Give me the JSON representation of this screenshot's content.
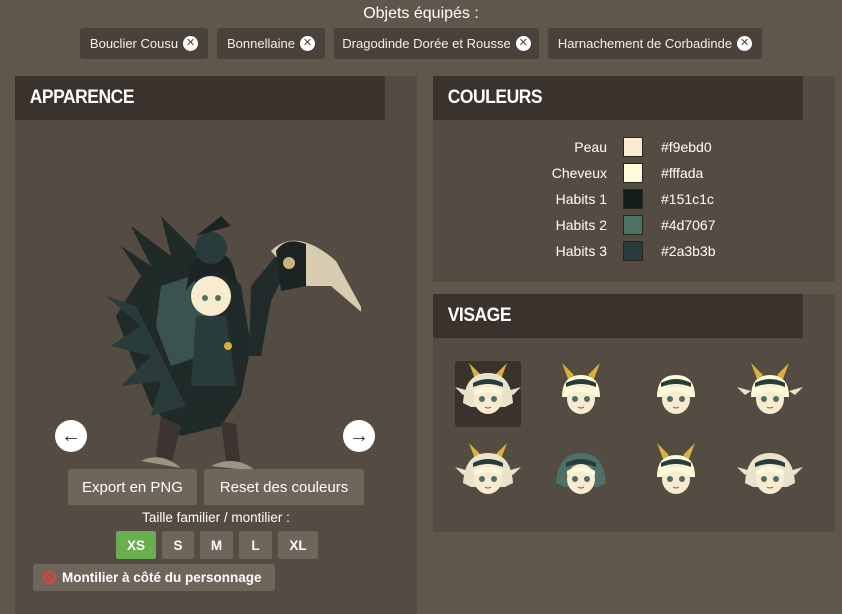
{
  "equipped": {
    "title": "Objets équipés :",
    "items": [
      {
        "label": "Bouclier Cousu"
      },
      {
        "label": "Bonnellaine"
      },
      {
        "label": "Dragodinde Dorée et Rousse"
      },
      {
        "label": "Harnachement de Corbadinde"
      }
    ],
    "remove_glyph": "✕"
  },
  "appearance": {
    "title": "APPARENCE",
    "prev_glyph": "←",
    "next_glyph": "→",
    "export_label": "Export en PNG",
    "reset_label": "Reset des couleurs",
    "size_label": "Taille familier / montilier :",
    "sizes": [
      "XS",
      "S",
      "M",
      "L",
      "XL"
    ],
    "selected_size": "XS",
    "mount_toggle_label": "Montilier à côté du personnage"
  },
  "colors": {
    "title": "COULEURS",
    "rows": [
      {
        "label": "Peau",
        "hex": "#f9ebd0"
      },
      {
        "label": "Cheveux",
        "hex": "#fffada"
      },
      {
        "label": "Habits 1",
        "hex": "#151c1c"
      },
      {
        "label": "Habits 2",
        "hex": "#4d7067"
      },
      {
        "label": "Habits 3",
        "hex": "#2a3b3b"
      }
    ]
  },
  "face": {
    "title": "VISAGE",
    "options": [
      {
        "name": "face-option-1",
        "selected": true
      },
      {
        "name": "face-option-2",
        "selected": false
      },
      {
        "name": "face-option-3",
        "selected": false
      },
      {
        "name": "face-option-4",
        "selected": false
      },
      {
        "name": "face-option-5",
        "selected": false
      },
      {
        "name": "face-option-6",
        "selected": false
      },
      {
        "name": "face-option-7",
        "selected": false
      },
      {
        "name": "face-option-8",
        "selected": false
      }
    ]
  },
  "theme": {
    "background": "#5f564c",
    "panel": "#544b42",
    "panel_header": "#3a332d",
    "button": "#6e655b",
    "active": "#6aaf4f"
  }
}
